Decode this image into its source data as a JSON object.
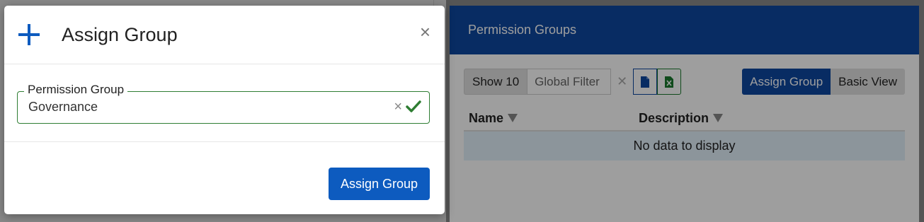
{
  "background": {
    "panel_title": "Permission Groups",
    "toolbar": {
      "show_label": "Show 10",
      "filter_placeholder": "Global Filter",
      "clear_symbol": "✕",
      "export_icons": [
        "file-icon",
        "excel-icon"
      ],
      "assign_group_label": "Assign Group",
      "basic_view_label": "Basic View"
    },
    "table": {
      "columns": [
        "Name",
        "Description"
      ],
      "empty_message": "No data to display"
    }
  },
  "modal": {
    "title": "Assign Group",
    "field": {
      "label": "Permission Group",
      "value": "Governance"
    },
    "submit_label": "Assign Group"
  },
  "colors": {
    "primary": "#0d5bbf",
    "header_blue": "#0d47a1",
    "success_green": "#2e7d32"
  }
}
